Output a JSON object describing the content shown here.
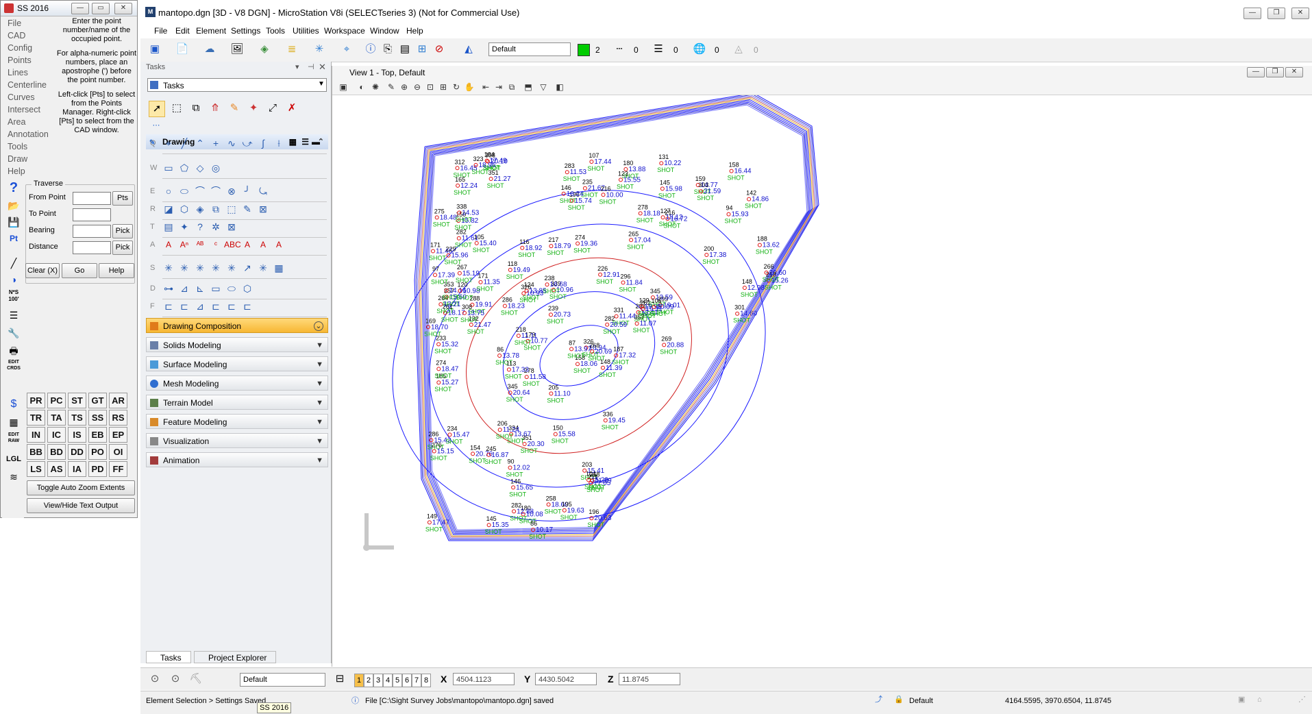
{
  "ss": {
    "title": "SS 2016",
    "menu": [
      "File",
      "CAD",
      "Config",
      "Points",
      "Lines",
      "Centerline",
      "Curves",
      "Intersect",
      "Area",
      "Annotation",
      "Tools",
      "Draw",
      "Help"
    ],
    "help_text": [
      "Enter the point number/name of the occupied point.",
      "For alpha-numeric point numbers, place an apostrophe (') before the point number.",
      "Left-click [Pts] to select from the Points Manager. Right-click [Pts] to select from the CAD window."
    ],
    "traverse": {
      "legend": "Traverse",
      "from_point": "From Point",
      "to_point": "To Point",
      "bearing": "Bearing",
      "distance": "Distance",
      "pts_btn": "Pts",
      "pick_btn": "Pick",
      "pick_btn2": "Pick"
    },
    "clear_btn": "Clear (X)",
    "go_btn": "Go",
    "help_btn": "Help",
    "codes": [
      "PR",
      "PC",
      "ST",
      "GT",
      "AR",
      "TR",
      "TA",
      "TS",
      "SS",
      "RS",
      "IN",
      "IC",
      "IS",
      "EB",
      "EP",
      "BB",
      "BD",
      "DD",
      "PO",
      "OI",
      "LS",
      "AS",
      "IA",
      "PD",
      "FF"
    ],
    "toggle_zoom": "Toggle Auto Zoom Extents",
    "toggle_text": "View/Hide Text Output",
    "side_labels": {
      "nhs": "N*S 100'",
      "edit_crds": "EDIT CRDS",
      "edit_raw": "EDIT RAW",
      "lgl": "LGL"
    }
  },
  "ms": {
    "title": "mantopo.dgn [3D - V8 DGN] - MicroStation V8i (SELECTseries 3) (Not for Commercial Use)",
    "menu": [
      "File",
      "Edit",
      "Element",
      "Settings",
      "Tools",
      "Utilities",
      "Workspace",
      "Window",
      "Help"
    ],
    "attributes": {
      "level": "Default",
      "color_num": "2",
      "style": "0",
      "weight": "0",
      "transp": "0",
      "priority": "0",
      "color": "#00cc00"
    },
    "tasks": {
      "header": "Tasks",
      "combo": "Tasks",
      "drawing": "Drawing",
      "row_letters": [
        "Q",
        "W",
        "E",
        "R",
        "T",
        "A",
        "S",
        "D",
        "F"
      ],
      "sections": [
        "Drawing Composition",
        "Solids Modeling",
        "Surface Modeling",
        "Mesh Modeling",
        "Terrain Model",
        "Feature Modeling",
        "Visualization",
        "Animation"
      ],
      "tabs": [
        "Tasks",
        "Project Explorer"
      ]
    },
    "view": {
      "title": "View 1 - Top, Default"
    },
    "views": [
      "1",
      "2",
      "3",
      "4",
      "5",
      "6",
      "7",
      "8"
    ],
    "coords": {
      "x_label": "X",
      "x": "4504.1123",
      "y_label": "Y",
      "y": "4430.5042",
      "z_label": "Z",
      "z": "11.8745"
    },
    "view_combo": "Default",
    "status": {
      "left": "Element Selection > Settings Saved",
      "tooltip": "SS 2016",
      "message": "File [C:\\Sight Survey Jobs\\mantopo\\mantopo.dgn] saved",
      "level": "Default",
      "coords": "4164.5595, 3970.6504, 11.8745"
    }
  }
}
